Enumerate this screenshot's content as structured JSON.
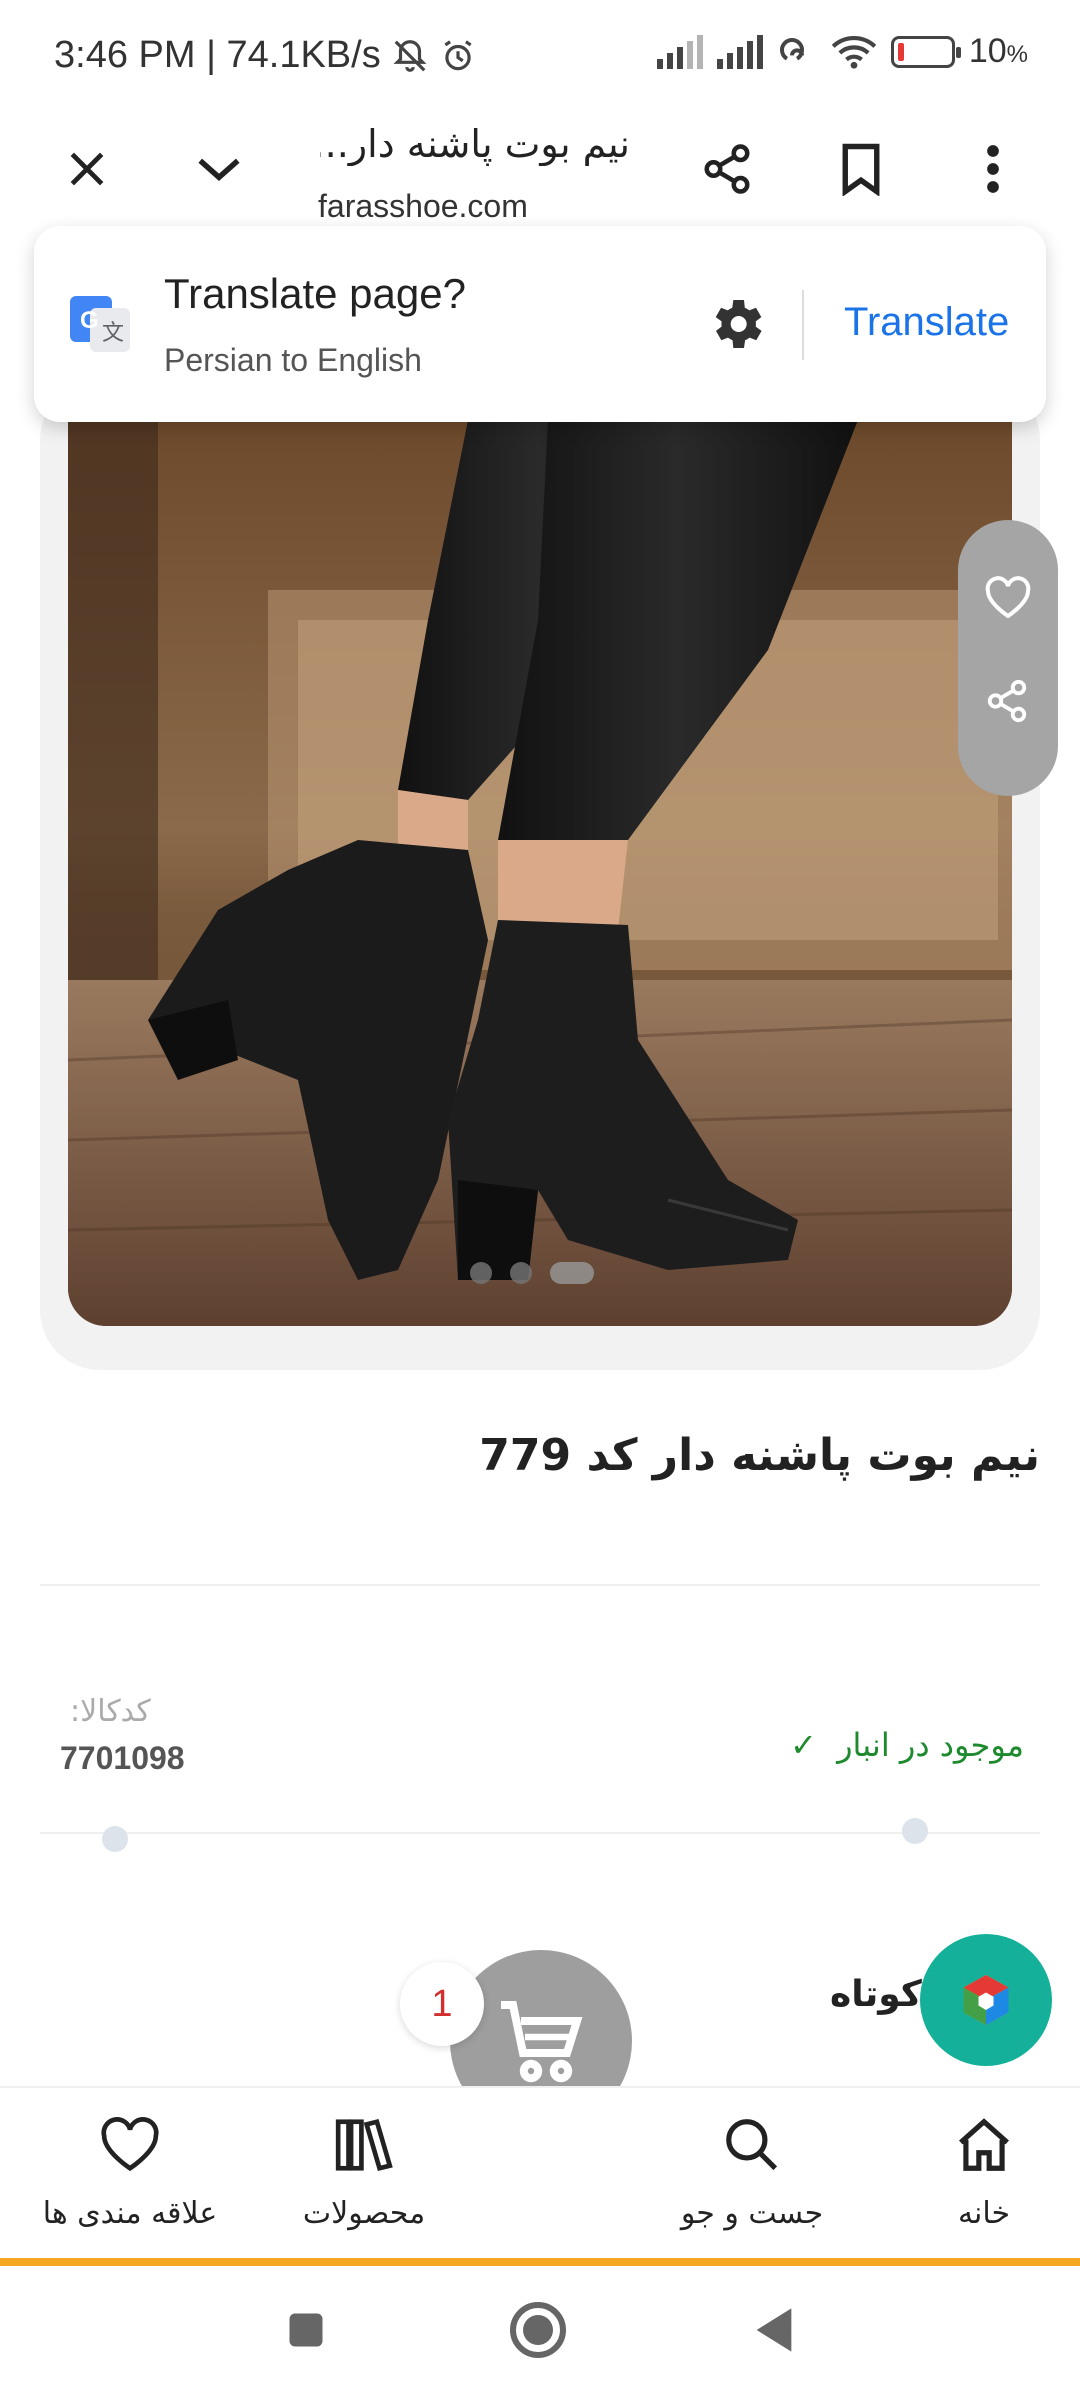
{
  "status_bar": {
    "time_speed": "3:46 PM | 74.1KB/s",
    "battery": "10",
    "battery_unit": "%"
  },
  "browser": {
    "page_title": "نیم بوت پاشنه دار...",
    "url": "farasshoe.com"
  },
  "translate_prompt": {
    "title": "Translate page?",
    "subtitle": "Persian to English",
    "action": "Translate"
  },
  "product": {
    "title": "نیم بوت پاشنه دار کد 779",
    "code_label": "کدکالا:",
    "code_value": "7701098",
    "stock_status": "موجود در انبار",
    "section_title": "کوتاه",
    "image_dots": 3,
    "image_active_index": 2
  },
  "cart": {
    "count": "1"
  },
  "bottom_nav": {
    "items": [
      {
        "label": "خانه",
        "icon": "home-icon"
      },
      {
        "label": "جست و جو",
        "icon": "search-icon"
      },
      {
        "label": "محصولات",
        "icon": "books-icon"
      },
      {
        "label": "علاقه مندی ها",
        "icon": "heart-icon"
      }
    ]
  },
  "colors": {
    "accent_blue": "#1a73e8",
    "stock_green": "#1e8a2e",
    "fab_teal": "#14b09a",
    "nav_orange": "#f5a623",
    "badge_red": "#d32f2f"
  }
}
